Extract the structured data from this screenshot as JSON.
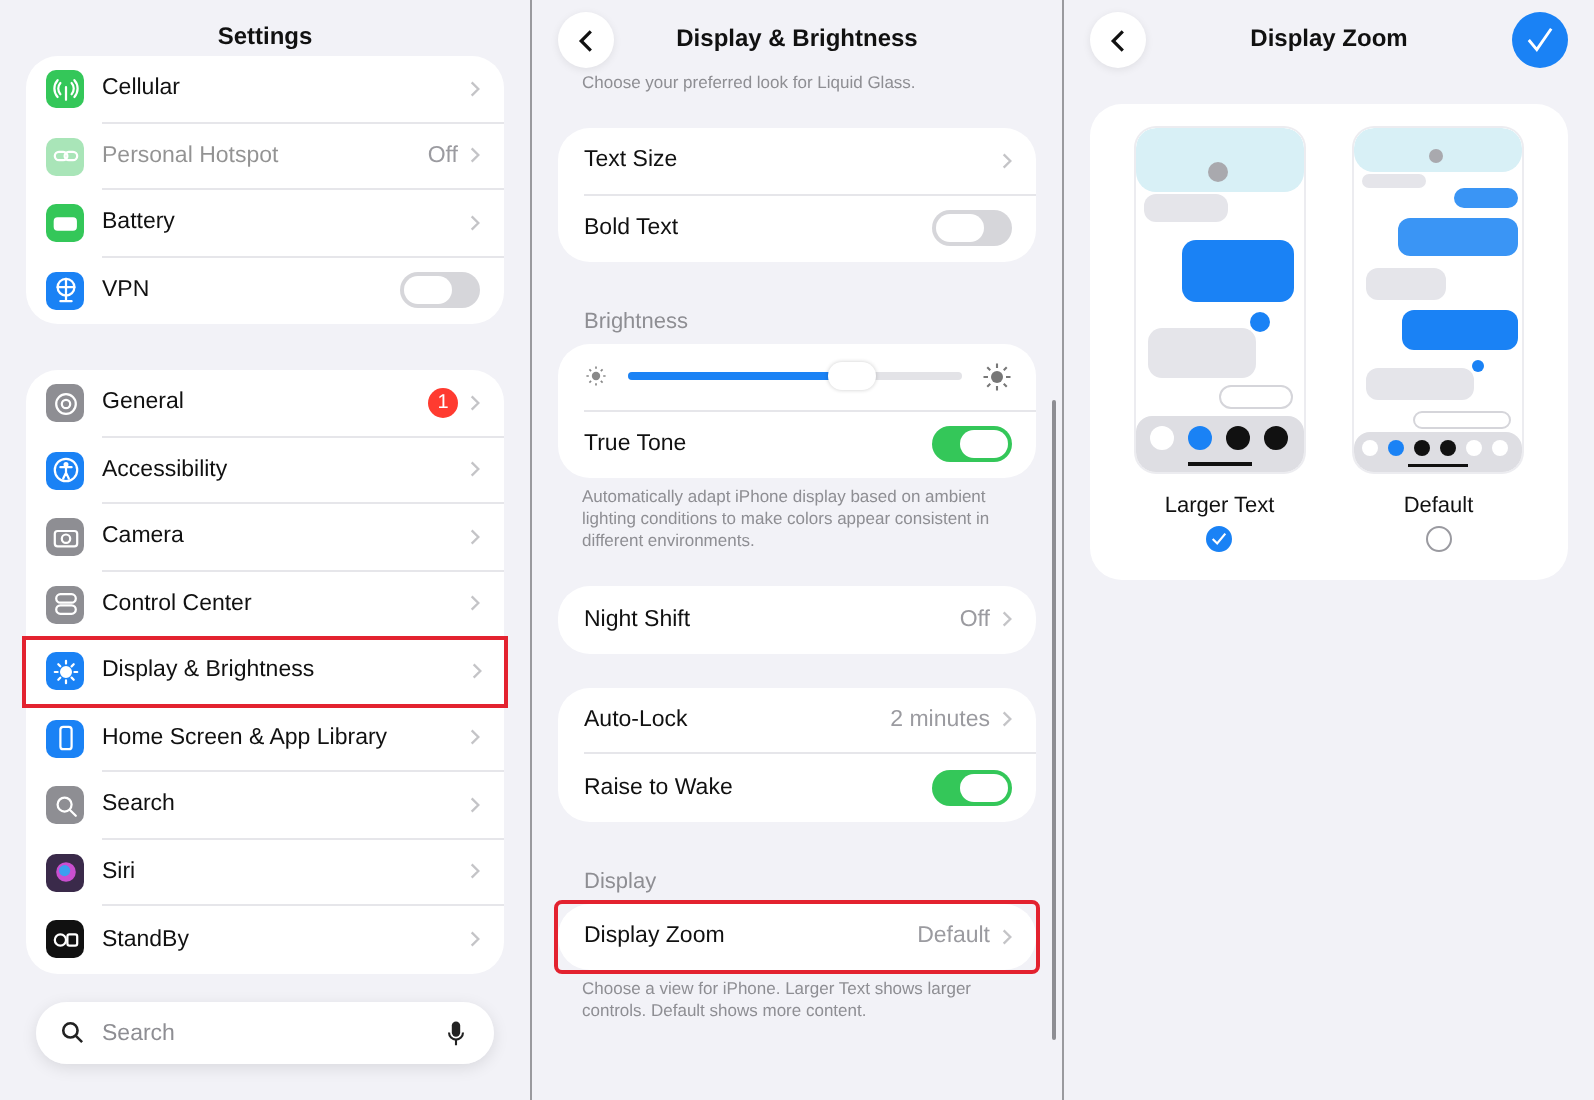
{
  "settings_panel": {
    "title": "Settings",
    "groups": [
      {
        "rows": [
          {
            "label": "Cellular",
            "kind": "link",
            "color": "#34c759",
            "disabled": false,
            "highlighted": false
          },
          {
            "label": "Personal Hotspot",
            "value": "Off",
            "kind": "link",
            "color": "#a9e5b8",
            "disabled": true,
            "highlighted": false
          },
          {
            "label": "Battery",
            "kind": "link",
            "color": "#34c759",
            "disabled": false,
            "highlighted": false
          },
          {
            "label": "VPN",
            "kind": "toggle",
            "on": false,
            "color": "#1a82f5",
            "disabled": false,
            "highlighted": false
          }
        ]
      },
      {
        "rows": [
          {
            "label": "General",
            "badge": "1",
            "kind": "link",
            "color": "#8e8e93",
            "disabled": false,
            "highlighted": false
          },
          {
            "label": "Accessibility",
            "kind": "link",
            "color": "#1a82f5",
            "disabled": false,
            "highlighted": false
          },
          {
            "label": "Camera",
            "kind": "link",
            "color": "#8e8e93",
            "disabled": false,
            "highlighted": false
          },
          {
            "label": "Control Center",
            "kind": "link",
            "color": "#8e8e93",
            "disabled": false,
            "highlighted": false
          },
          {
            "label": "Display & Brightness",
            "kind": "link",
            "color": "#1a82f5",
            "disabled": false,
            "highlighted": true
          },
          {
            "label": "Home Screen & App Library",
            "kind": "link",
            "color": "#1a82f5",
            "disabled": false,
            "highlighted": false
          },
          {
            "label": "Search",
            "kind": "link",
            "color": "#8e8e93",
            "disabled": false,
            "highlighted": false
          },
          {
            "label": "Siri",
            "kind": "link",
            "color": "#3a2a4a",
            "disabled": false,
            "highlighted": false
          },
          {
            "label": "StandBy",
            "kind": "link",
            "color": "#111111",
            "disabled": false,
            "highlighted": false
          }
        ]
      }
    ],
    "search": {
      "placeholder": "Search"
    }
  },
  "display_panel": {
    "title": "Display & Brightness",
    "intro_note": "Choose your preferred look for Liquid Glass.",
    "sections": [
      {
        "rows": [
          {
            "label": "Text Size",
            "kind": "link",
            "highlighted": false
          },
          {
            "label": "Bold Text",
            "kind": "toggle",
            "on": false,
            "highlighted": false
          }
        ]
      },
      {
        "header": "Brightness",
        "rows": [
          {
            "kind": "slider",
            "level": 0.74,
            "highlighted": false
          },
          {
            "label": "True Tone",
            "kind": "toggle",
            "on": true,
            "highlighted": false
          }
        ],
        "footer": "Automatically adapt iPhone display based on ambient lighting conditions to make colors appear consistent in different environments."
      },
      {
        "rows": [
          {
            "label": "Night Shift",
            "value": "Off",
            "kind": "link",
            "highlighted": false
          }
        ]
      },
      {
        "rows": [
          {
            "label": "Auto-Lock",
            "value": "2 minutes",
            "kind": "link",
            "highlighted": false
          },
          {
            "label": "Raise to Wake",
            "kind": "toggle",
            "on": true,
            "highlighted": false
          }
        ]
      },
      {
        "header": "Display",
        "rows": [
          {
            "label": "Display Zoom",
            "value": "Default",
            "kind": "link",
            "highlighted": true
          }
        ],
        "footer": "Choose a view for iPhone. Larger Text shows larger controls. Default shows more content."
      }
    ]
  },
  "zoom_panel": {
    "title": "Display Zoom",
    "options": [
      {
        "label": "Larger Text",
        "kind": "large",
        "selected": true
      },
      {
        "label": "Default",
        "kind": "standard",
        "selected": false
      }
    ]
  }
}
